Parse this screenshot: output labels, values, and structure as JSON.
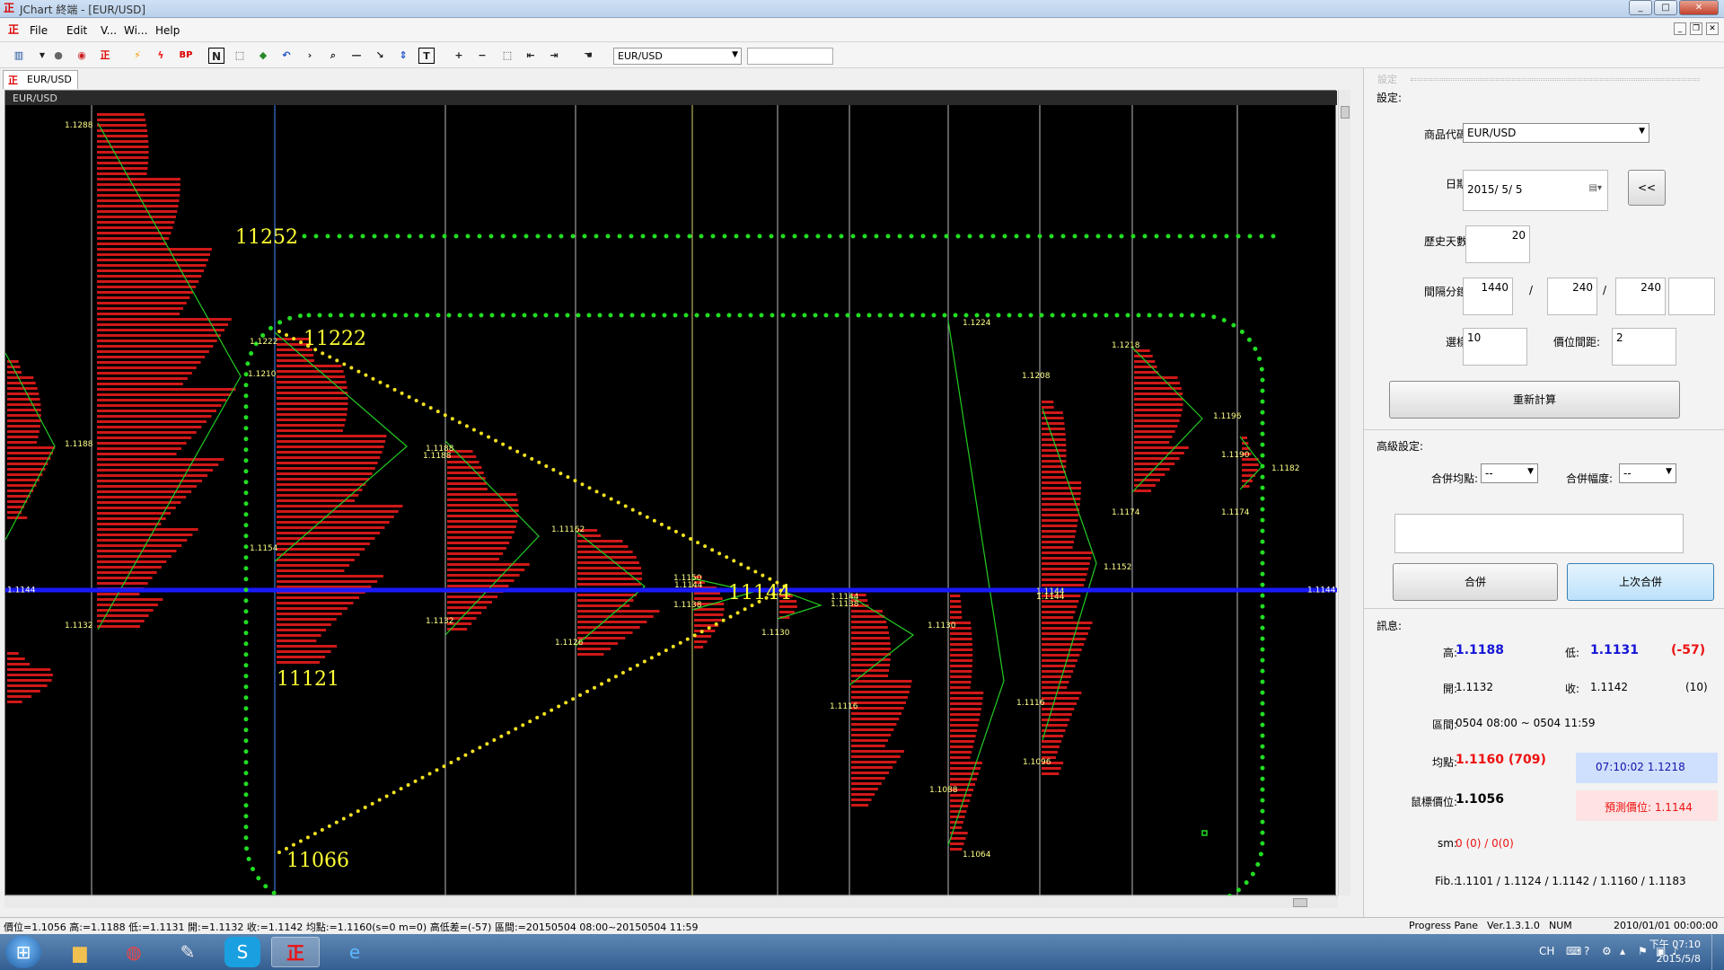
{
  "window": {
    "title": "JChart 終端 - [EUR/USD]",
    "min": "_",
    "max": "□",
    "close": "✕"
  },
  "menu": [
    "File",
    "Edit",
    "V...",
    "Wi...",
    "Help"
  ],
  "toolbar": {
    "symbol": "EUR/USD",
    "bp_label": "BP",
    "n_label": "N",
    "t_label": "T"
  },
  "tab": {
    "label": "EUR/USD"
  },
  "chart": {
    "header": "EUR/USD",
    "annotations": {
      "upper_line": "11252",
      "high": "11222",
      "low_left": "11121",
      "low": "11066",
      "apex": "11144"
    },
    "price_labels": [
      "1.1288",
      "1.1210",
      "1.1188",
      "1.1132",
      "1.1222",
      "1.1188",
      "1.1154",
      "1.1188",
      "1.1132",
      "1.11162",
      "1.1126",
      "1.1150",
      "1.1138",
      "1.1144",
      "1.1130",
      "1.1144",
      "1.1138",
      "1.1116",
      "1.1130",
      "1.1144",
      "1.1224",
      "1.1088",
      "1.1064",
      "1.1116",
      "1.1208",
      "1.1144",
      "1.1096",
      "1.1152",
      "1.1218",
      "1.1174",
      "1.1196",
      "1.1190",
      "1.1174",
      "1.1182"
    ],
    "current_price_left": "1.1144",
    "current_price_right": "1.1144"
  },
  "panel": {
    "header": "設定",
    "settings_title": "設定:",
    "symbol_label": "商品代碼:",
    "symbol_value": "EUR/USD",
    "date_label": "日期:",
    "date_value": "2015/  5/  5",
    "back_button": "<<",
    "history_label": "歷史天數:",
    "history_value": "20",
    "interval_label": "間隔分鐘:",
    "interval_1": "1440",
    "interval_2": "240",
    "interval_3": "240",
    "slash": "/",
    "choose_label": "選樣:",
    "choose_value": "10",
    "digits_label": "價位間距:",
    "digits_value": "2",
    "recalc_button": "重新計算",
    "advanced_title": "高級設定:",
    "merge_point_label": "合併均點:",
    "merge_point_value": "--",
    "merge_range_label": "合併幅度:",
    "merge_range_value": "--",
    "merge_button": "合併",
    "last_merge_button": "上次合併",
    "info_title": "訊息:",
    "high_label": "高:",
    "high_value": "1.1188",
    "low_label": "低:",
    "low_value": "1.1131",
    "diff_value": "(-57)",
    "open_label": "開:",
    "open_value": "1.1132",
    "close_label": "收:",
    "close_value": "1.1142",
    "count_value": "(10)",
    "range_label": "區間:",
    "range_value": "0504 08:00 ~ 0504 11:59",
    "avg_label": "均點:",
    "avg_value": "1.1160 (709)",
    "clock_value": "07:10:02  1.1218",
    "cursor_label": "鼠標價位:",
    "cursor_value": "1.1056",
    "pred_value": "預測價位: 1.1144",
    "sm_label": "sm:",
    "sm_value": "0 (0) / 0(0)",
    "fib_label": "Fib.:",
    "fib_value": "1.1101 / 1.1124 / 1.1142 / 1.1160 / 1.1183"
  },
  "status": {
    "left": "價位=1.1056  高:=1.1188  低:=1.1131  開:=1.1132  收:=1.1142  均點:=1.1160(s=0 m=0)  高低差=(-57)  區間:=20150504 08:00~20150504 11:59",
    "progress": "Progress Pane",
    "version": "Ver.1.3.1.0",
    "num": "NUM",
    "datetime": "2010/01/01 00:00:00"
  },
  "taskbar": {
    "lang": "CH",
    "time": "下午 07:10",
    "date": "2015/5/8"
  }
}
